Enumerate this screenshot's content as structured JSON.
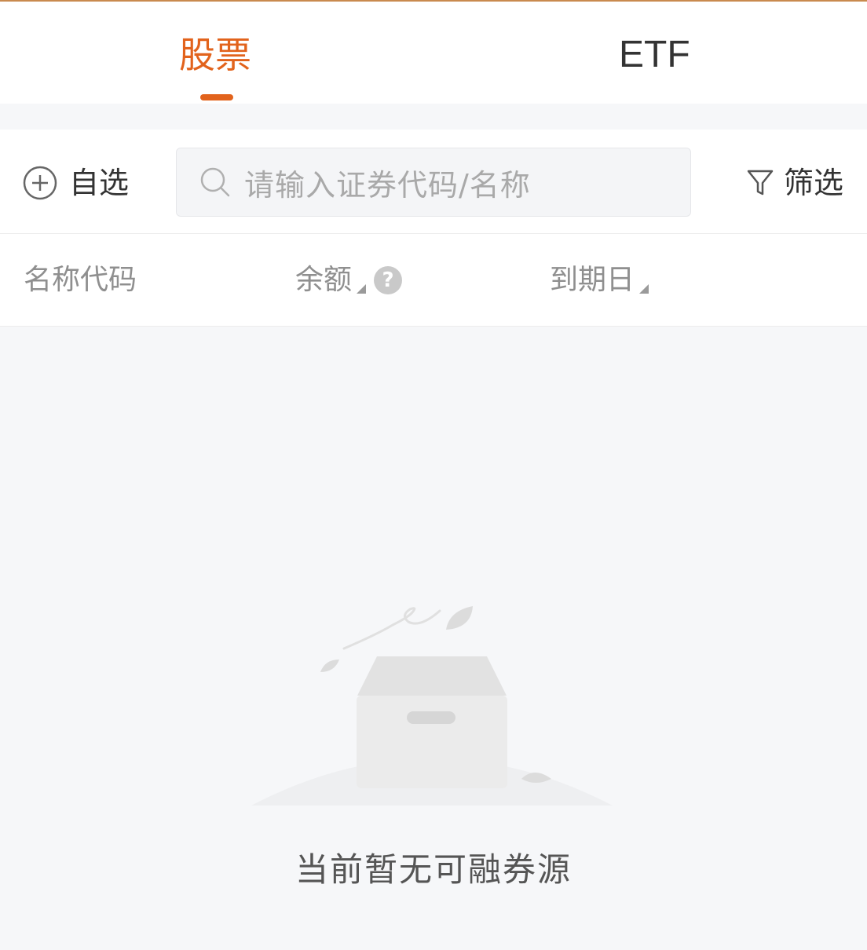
{
  "tabs": [
    {
      "label": "股票",
      "active": true
    },
    {
      "label": "ETF",
      "active": false
    }
  ],
  "toolbar": {
    "watch_label": "自选",
    "search_placeholder": "请输入证券代码/名称",
    "filter_label": "筛选"
  },
  "columns": {
    "name": "名称代码",
    "balance": "余额",
    "date": "到期日",
    "help_glyph": "?"
  },
  "empty": {
    "message": "当前暂无可融券源"
  },
  "colors": {
    "accent": "#e2631c",
    "text": "#333333",
    "muted": "#8f8f8f"
  }
}
